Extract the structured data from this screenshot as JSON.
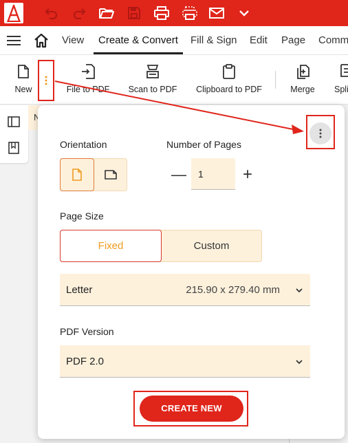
{
  "colors": {
    "brand": "#e0251b",
    "accent_orange": "#f09a1f",
    "field_bg": "#fdf1dc"
  },
  "titlebar": {
    "icons": [
      "app-logo",
      "undo-icon",
      "redo-icon",
      "open-folder-icon",
      "save-icon",
      "print-icon",
      "print-preview-icon",
      "email-icon",
      "chevron-down-icon"
    ]
  },
  "menu": {
    "items": [
      "View",
      "Create & Convert",
      "Fill & Sign",
      "Edit",
      "Page",
      "Comm"
    ],
    "active": "Create & Convert"
  },
  "ribbon": {
    "new_label": "New",
    "file_to_pdf_label": "File to PDF",
    "scan_to_pdf_label": "Scan to PDF",
    "clipboard_to_pdf_label": "Clipboard to PDF",
    "merge_label": "Merge",
    "split_label": "Split"
  },
  "doc_tab": {
    "initial": "N"
  },
  "popup": {
    "orientation_label": "Orientation",
    "pages_label": "Number of Pages",
    "pages_value": "1",
    "minus": "—",
    "plus": "+",
    "page_size_label": "Page Size",
    "fixed_label": "Fixed",
    "custom_label": "Custom",
    "paper": "Letter",
    "paper_dimensions": "215.90 x 279.40 mm",
    "pdf_version_label": "PDF Version",
    "pdf_version": "PDF 2.0",
    "create_label": "CREATE NEW"
  }
}
